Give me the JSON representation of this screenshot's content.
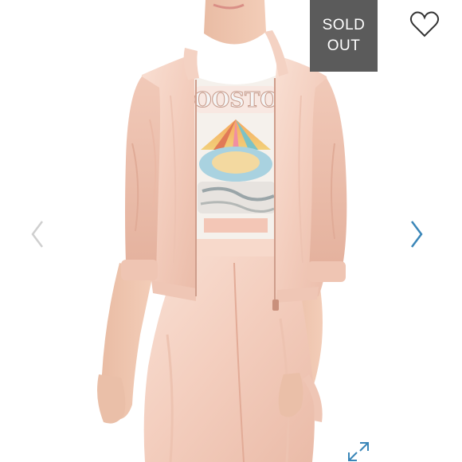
{
  "listing": {
    "status_badge": {
      "line1": "SOLD",
      "line2": "OUT",
      "background_color": "#5b5b5b",
      "text_color": "#ffffff"
    },
    "like_icon": "heart-outline-icon",
    "prev_icon": "chevron-left-icon",
    "next_icon": "chevron-right-icon",
    "expand_icon": "expand-arrows-icon",
    "colors": {
      "prev_arrow": "#cfcfcf",
      "next_arrow": "#3a86b8",
      "heart": "#333333",
      "garment": "#f6d2c2"
    }
  }
}
